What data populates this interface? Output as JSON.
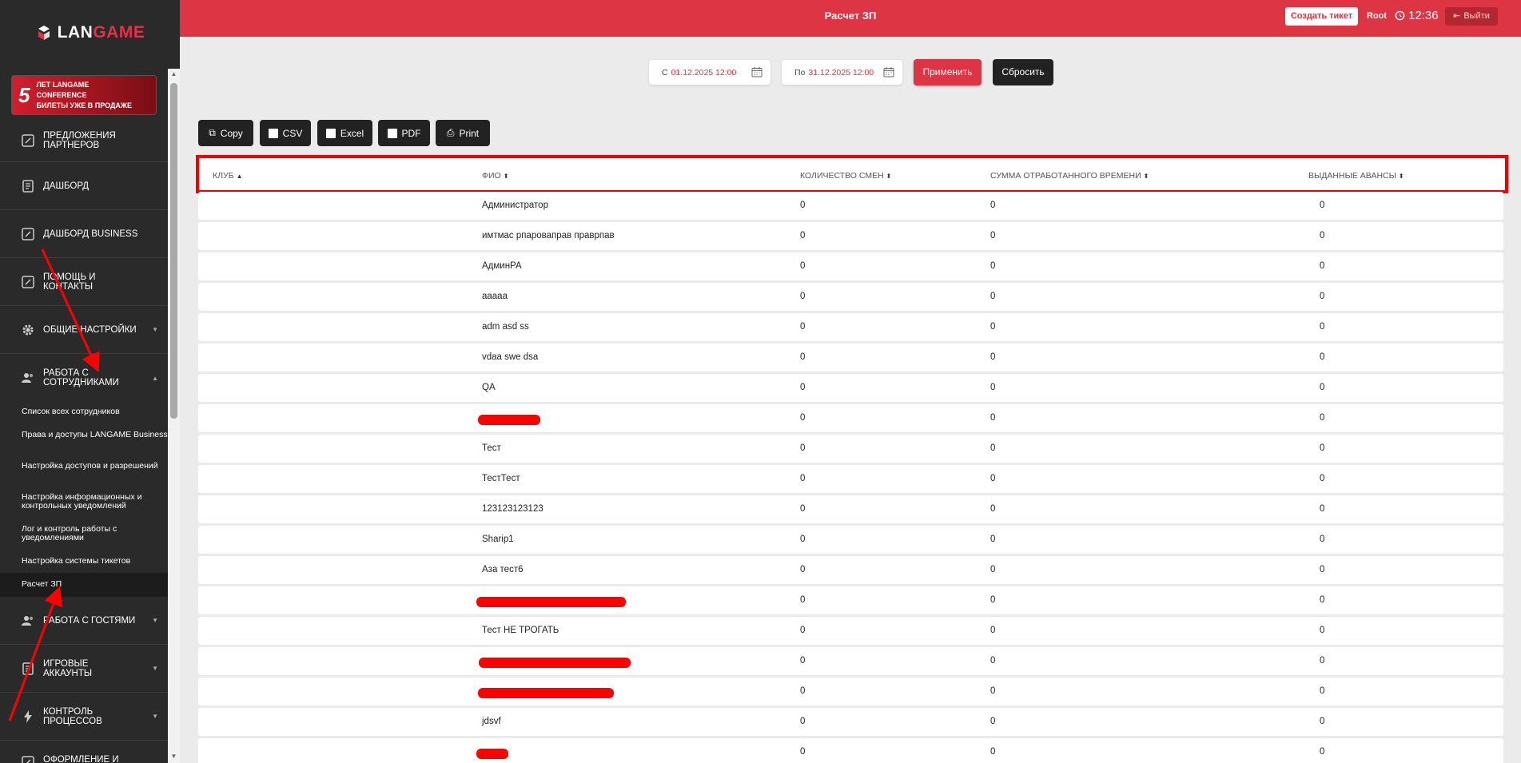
{
  "logo": {
    "part1": "LAN",
    "part2": "GAME"
  },
  "promo": {
    "number": "5",
    "line1": "ЛЕТ LANGAME",
    "line2": "CONFERENCE",
    "line3": "БИЛЕТЫ УЖЕ В ПРОДАЖЕ"
  },
  "sidebar": {
    "items": [
      {
        "label": "ПРЕДЛОЖЕНИЯ ПАРТНЕРОВ",
        "icon": "edit-icon"
      },
      {
        "label": "ДАШБОРД",
        "icon": "document-icon"
      },
      {
        "label": "ДАШБОРД BUSINESS",
        "icon": "edit-icon"
      },
      {
        "label": "ПОМОЩЬ И КОНТАКТЫ",
        "icon": "edit-icon"
      },
      {
        "label": "ОБЩИЕ НАСТРОЙКИ",
        "icon": "gear-icon"
      },
      {
        "label": "РАБОТА С СОТРУДНИКАМИ",
        "icon": "users-icon"
      },
      {
        "label": "РАБОТА С ГОСТЯМИ",
        "icon": "users-icon"
      },
      {
        "label": "ИГРОВЫЕ АККАУНТЫ",
        "icon": "document-icon"
      },
      {
        "label": "КОНТРОЛЬ ПРОЦЕССОВ",
        "icon": "bolt-icon"
      },
      {
        "label": "ОФОРМЛЕНИЕ И",
        "icon": "edit-icon"
      }
    ],
    "subitems": [
      "Список всех сотрудников",
      "Права и доступы LANGAME Business",
      "Настройка доступов и разрешений",
      "Настройка информационных и контрольных уведомлений",
      "Лог и контроль работы с уведомлениями",
      "Настройка системы тикетов",
      "Расчет ЗП"
    ]
  },
  "header": {
    "title": "Расчет ЗП",
    "ticket_button": "Создать тикет",
    "user": "Root",
    "time": "12:36",
    "logout": "Выйти"
  },
  "filters": {
    "from_prefix": "С",
    "from_value": "01.12.2025 12:00",
    "to_prefix": "По",
    "to_value": "31.12.2025 12:00",
    "apply": "Применить",
    "reset": "Сбросить"
  },
  "export": {
    "copy": "Copy",
    "csv": "CSV",
    "excel": "Excel",
    "pdf": "PDF",
    "print": "Print"
  },
  "table": {
    "columns": [
      "КЛУБ",
      "ФИО",
      "КОЛИЧЕСТВО СМЕН",
      "СУММА ОТРАБОТАННОГО ВРЕМЕНИ",
      "ВЫДАННЫЕ АВАНСЫ"
    ],
    "rows": [
      {
        "club": "",
        "name": "Администратор",
        "shifts": "0",
        "time": "0",
        "advances": "0"
      },
      {
        "club": "",
        "name": "имтмас рпароваправ праврпав",
        "shifts": "0",
        "time": "0",
        "advances": "0"
      },
      {
        "club": "",
        "name": "АдминРА",
        "shifts": "0",
        "time": "0",
        "advances": "0"
      },
      {
        "club": "",
        "name": "ааааа",
        "shifts": "0",
        "time": "0",
        "advances": "0"
      },
      {
        "club": "",
        "name": "adm asd ss",
        "shifts": "0",
        "time": "0",
        "advances": "0"
      },
      {
        "club": "",
        "name": "vdaa swe dsa",
        "shifts": "0",
        "time": "0",
        "advances": "0"
      },
      {
        "club": "",
        "name": "QA",
        "shifts": "0",
        "time": "0",
        "advances": "0"
      },
      {
        "club": "",
        "name": "",
        "shifts": "0",
        "time": "0",
        "advances": "0"
      },
      {
        "club": "",
        "name": "Тест",
        "shifts": "0",
        "time": "0",
        "advances": "0"
      },
      {
        "club": "",
        "name": "ТестТест",
        "shifts": "0",
        "time": "0",
        "advances": "0"
      },
      {
        "club": "",
        "name": "123123123123",
        "shifts": "0",
        "time": "0",
        "advances": "0"
      },
      {
        "club": "",
        "name": "Sharip1",
        "shifts": "0",
        "time": "0",
        "advances": "0"
      },
      {
        "club": "",
        "name": "Аза тест6",
        "shifts": "0",
        "time": "0",
        "advances": "0"
      },
      {
        "club": "",
        "name": "",
        "shifts": "0",
        "time": "0",
        "advances": "0"
      },
      {
        "club": "",
        "name": "Тест НЕ ТРОГАТЬ",
        "shifts": "0",
        "time": "0",
        "advances": "0"
      },
      {
        "club": "",
        "name": "",
        "shifts": "0",
        "time": "0",
        "advances": "0"
      },
      {
        "club": "",
        "name": "",
        "shifts": "0",
        "time": "0",
        "advances": "0"
      },
      {
        "club": "",
        "name": "jdsvf",
        "shifts": "0",
        "time": "0",
        "advances": "0"
      },
      {
        "club": "",
        "name": "",
        "shifts": "0",
        "time": "0",
        "advances": "0"
      }
    ]
  },
  "colors": {
    "accent": "#de3545",
    "sidebar": "#2a2a2a",
    "annotation": "#ff0000"
  }
}
